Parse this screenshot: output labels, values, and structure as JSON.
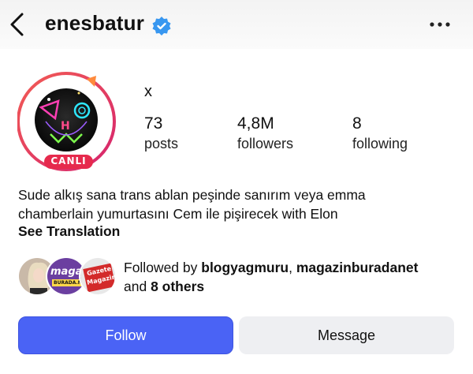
{
  "header": {
    "username": "enesbatur"
  },
  "profile": {
    "display_name": "x",
    "avatar_badge_text": "CANLI",
    "stats": [
      {
        "value": "73",
        "label": "posts"
      },
      {
        "value": "4,8M",
        "label": "followers"
      },
      {
        "value": "8",
        "label": "following"
      }
    ],
    "bio_lines": [
      "Sude alkış sana trans ablan peşinde sanırım veya emma",
      "chamberlain yumurtasını Cem ile pişirecek with Elon"
    ],
    "see_translation": "See Translation"
  },
  "followed_by": {
    "prefix": "Followed by ",
    "user1": "blogyagmuru",
    "separator": ", ",
    "user2": "magazinburadanet",
    "and_text": "and ",
    "others": "8 others",
    "avatar2_text_top": "magazin",
    "avatar2_text_bottom": "BURADA.NET",
    "avatar3_text_top": "Gazete",
    "avatar3_text_bottom": "Magazin"
  },
  "actions": {
    "follow_label": "Follow",
    "message_label": "Message"
  },
  "colors": {
    "primary_button": "#4a63f5",
    "verified_badge": "#3897f0",
    "story_ring": "#e0365b"
  }
}
